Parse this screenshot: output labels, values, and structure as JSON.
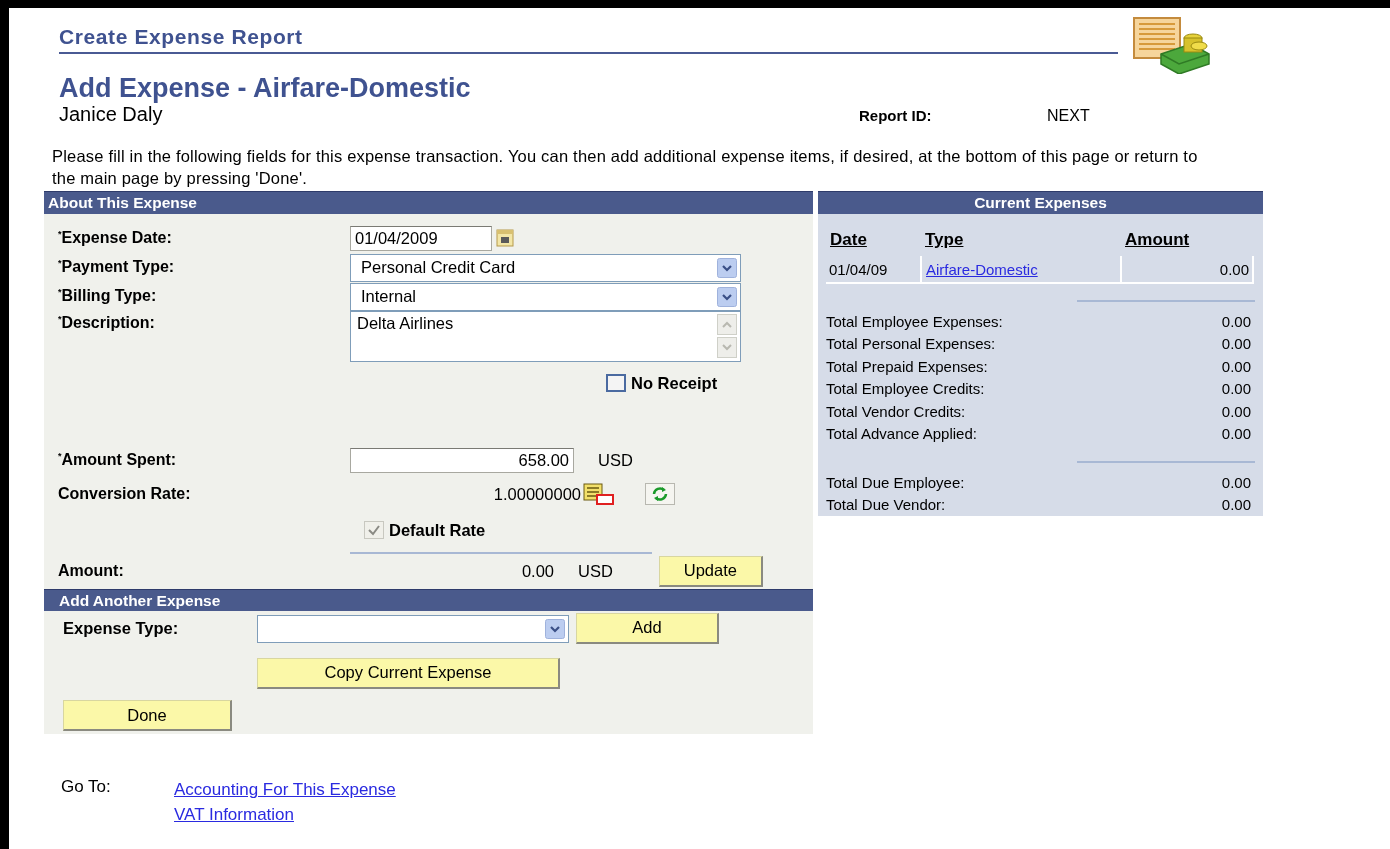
{
  "header": {
    "title": "Create Expense Report"
  },
  "page_title": "Add Expense - Airfare-Domestic",
  "employee_name": "Janice Daly",
  "report_id": {
    "label": "Report ID:",
    "value": "NEXT"
  },
  "instructions": "Please fill in the following fields for this expense transaction. You can then add additional expense items, if desired, at the bottom of this page or return to the main page by pressing 'Done'.",
  "about_this_expense": {
    "title": "About This Expense",
    "expense_date": {
      "label": "$^{*}$Expense Date:",
      "value": "01/04/2009"
    },
    "payment_type": {
      "label": "$^{*}$Payment Type:",
      "value": "Personal Credit Card"
    },
    "billing_type": {
      "label": "$^{*}$Billing Type:",
      "value": "Internal"
    },
    "description": {
      "label": "$^{*}$Description:",
      "value": "Delta Airlines"
    },
    "no_receipt": {
      "label": "No Receipt",
      "checked": false
    },
    "amount_spent": {
      "label": "$^{*}$Amount Spent:",
      "value": "658.00",
      "currency": "USD"
    },
    "conversion_rate": {
      "label": "Conversion Rate:",
      "value": "1.00000000"
    },
    "default_rate": {
      "label": "Default Rate",
      "checked": true,
      "disabled": true
    },
    "amount": {
      "label": "Amount:",
      "value": "0.00",
      "currency": "USD"
    },
    "update_button": "Update"
  },
  "add_another_expense": {
    "title": "Add Another Expense",
    "expense_type_label": "Expense Type:",
    "add_button": "Add",
    "copy_button": "Copy Current Expense",
    "done_button": "Done"
  },
  "current_expenses": {
    "title": "Current Expenses",
    "columns": [
      "Date",
      "Type",
      "Amount"
    ],
    "rows": [
      {
        "date": "01/04/09",
        "type": "Airfare-Domestic",
        "amount": "0.00"
      }
    ],
    "total_groups": [
      {
        "items": [
          {
            "label": "Total Employee Expenses:",
            "value": "0.00"
          },
          {
            "label": "Total Personal Expenses:",
            "value": "0.00"
          },
          {
            "label": "Total Prepaid Expenses:",
            "value": "0.00"
          },
          {
            "label": "Total Employee Credits:",
            "value": "0.00"
          },
          {
            "label": "Total Vendor Credits:",
            "value": "0.00"
          },
          {
            "label": "Total Advance Applied:",
            "value": "0.00"
          }
        ]
      },
      {
        "items": [
          {
            "label": "Total Due Employee:",
            "value": "0.00"
          },
          {
            "label": "Total Due Vendor:",
            "value": "0.00"
          }
        ]
      }
    ]
  },
  "go_to": {
    "label": "Go To:",
    "links": [
      "Accounting For This Expense",
      "VAT Information"
    ]
  }
}
